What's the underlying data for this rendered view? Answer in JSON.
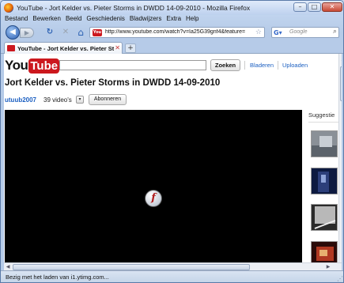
{
  "window": {
    "title": "YouTube - Jort Kelder vs. Pieter Storms in DWDD 14-09-2010 - Mozilla Firefox",
    "minimize": "–",
    "maximize": "□",
    "close": "✕"
  },
  "menu": [
    "Bestand",
    "Bewerken",
    "Beeld",
    "Geschiedenis",
    "Bladwijzers",
    "Extra",
    "Help"
  ],
  "nav": {
    "url": "http://www.youtube.com/watch?v=Ia25G39gnf4&feature=",
    "search_placeholder": "Google",
    "back_glyph": "◀",
    "forward_glyph": "▶",
    "reload_glyph": "↻",
    "stop_glyph": "✕",
    "home_glyph": "⌂",
    "star_glyph": "☆",
    "search_glyph": "⌕",
    "url_fav_text": "You"
  },
  "tabs": [
    {
      "label": "YouTube - Jort Kelder vs. Pieter Stor...",
      "close": "✕"
    }
  ],
  "newtab_glyph": "+",
  "youtube": {
    "logo_you": "You",
    "logo_tube": "Tube",
    "search_button": "Zoeken",
    "link_browse": "Bladeren",
    "link_upload": "Uploaden",
    "video_title": "Jort Kelder vs. Pieter Storms in DWDD 14-09-2010",
    "channel": "utuub2007",
    "video_count": "39 video's",
    "dropdown_glyph": "▾",
    "subscribe": "Abonneren",
    "suggestions_label": "Suggestie",
    "flash_glyph": "f"
  },
  "status": {
    "text": "Bezig met het laden van i1.ytimg.com..."
  },
  "colors": {
    "brand_red": "#cc181e",
    "link_blue": "#1b5fc1"
  },
  "icons": [
    "firefox-icon",
    "back-icon",
    "forward-icon",
    "reload-icon",
    "stop-icon",
    "home-icon",
    "star-icon",
    "google-icon",
    "search-icon",
    "flash-icon"
  ]
}
